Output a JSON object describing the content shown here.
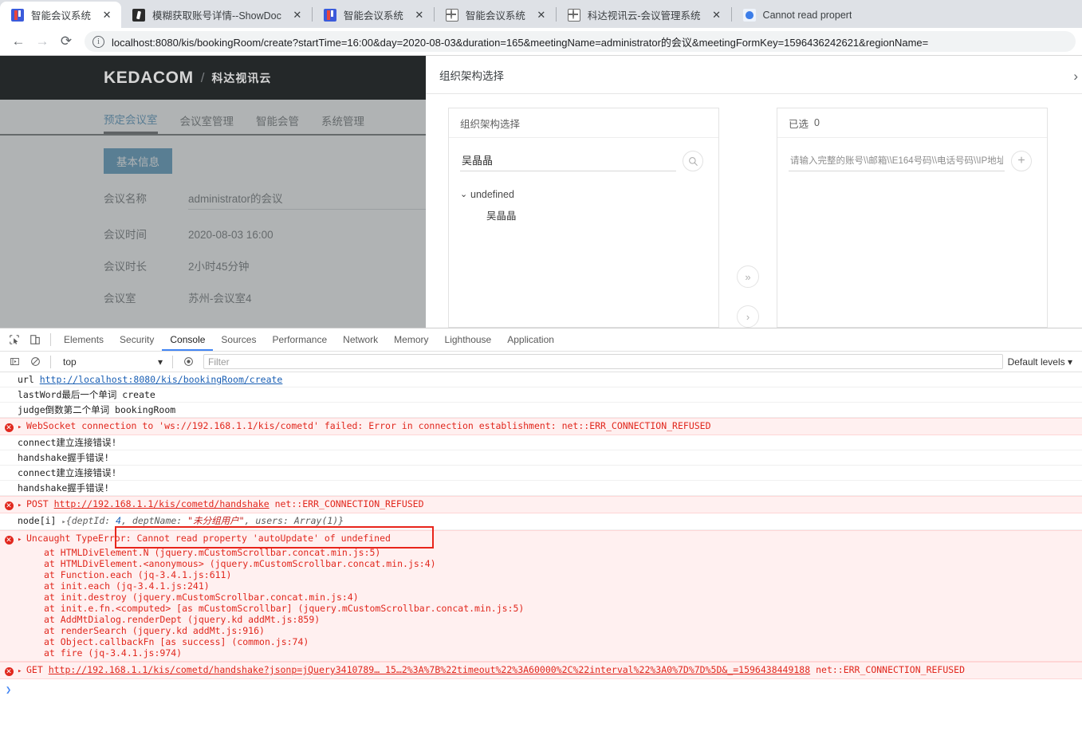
{
  "browser": {
    "tabs": [
      {
        "title": "智能会议系统",
        "favicon": "fiddler-icon",
        "active": true,
        "close": "✕"
      },
      {
        "title": "模糊获取账号详情--ShowDoc",
        "favicon": "showdoc-icon",
        "active": false,
        "close": "✕"
      },
      {
        "title": "智能会议系统",
        "favicon": "fiddler-icon",
        "active": false,
        "close": "✕"
      },
      {
        "title": "智能会议系统",
        "favicon": "globe-icon",
        "active": false,
        "close": "✕"
      },
      {
        "title": "科达视讯云-会议管理系统",
        "favicon": "globe-icon",
        "active": false,
        "close": "✕"
      },
      {
        "title": "Cannot read propert",
        "favicon": "baidu-icon",
        "active": false,
        "close": ""
      }
    ],
    "nav": {
      "back": "←",
      "forward": "→",
      "reload": "⟳",
      "info": "ⓘ"
    },
    "url": "localhost:8080/kis/bookingRoom/create?startTime=16:00&day=2020-08-03&duration=165&meetingName=administrator的会议&meetingFormKey=1596436242621&regionName="
  },
  "page": {
    "brand": {
      "name": "KEDACOM",
      "separator": "/",
      "subtitle": "科达视讯云"
    },
    "nav_tabs": [
      {
        "label": "预定会议室",
        "active": true
      },
      {
        "label": "会议室管理",
        "active": false
      },
      {
        "label": "智能会管",
        "active": false
      },
      {
        "label": "系统管理",
        "active": false
      }
    ],
    "section_button": "基本信息",
    "form": [
      {
        "label": "会议名称",
        "value": "administrator的会议",
        "underlined": true
      },
      {
        "label": "会议时间",
        "value": "2020-08-03 16:00",
        "underlined": false
      },
      {
        "label": "会议时长",
        "value": "2小时45分钟",
        "underlined": false
      },
      {
        "label": "会议室",
        "value": "苏州-会议室4",
        "underlined": false
      }
    ]
  },
  "modal": {
    "title": "组织架构选择",
    "close_icon": "›",
    "left_panel": {
      "header": "组织架构选择",
      "search_value": "吴晶晶",
      "search_placeholder": "",
      "search_icon": "search-icon",
      "tree": {
        "caret": "⌄",
        "root_label": "undefined",
        "children": [
          "吴晶晶"
        ]
      }
    },
    "transfer": {
      "move_all_icon": "»",
      "move_one_icon": "›"
    },
    "right_panel": {
      "header": "已选",
      "count": "0",
      "input_value": "",
      "input_placeholder": "请输入完整的账号\\\\邮箱\\\\E164号码\\\\电话号码\\\\IP地址",
      "add_icon": "+"
    }
  },
  "devtools": {
    "toolbar_icons": [
      "inspect-element-icon",
      "device-toolbar-icon"
    ],
    "tabs": [
      {
        "label": "Elements",
        "active": false
      },
      {
        "label": "Security",
        "active": false
      },
      {
        "label": "Console",
        "active": true
      },
      {
        "label": "Sources",
        "active": false
      },
      {
        "label": "Performance",
        "active": false
      },
      {
        "label": "Network",
        "active": false
      },
      {
        "label": "Memory",
        "active": false
      },
      {
        "label": "Lighthouse",
        "active": false
      },
      {
        "label": "Application",
        "active": false
      }
    ],
    "filterbar": {
      "execute_icon": "▶|",
      "clear_icon": "⊘",
      "context": "top",
      "context_caret": "▾",
      "eye_icon": "◉",
      "filter_placeholder": "Filter",
      "filter_value": "",
      "levels": "Default levels ▾"
    },
    "console_rows": [
      {
        "type": "log",
        "text": "url ",
        "link": "http://localhost:8080/kis/bookingRoom/create"
      },
      {
        "type": "log",
        "text": "lastWord最后一个单词 create"
      },
      {
        "type": "log",
        "text": "judge倒数第二个单词 bookingRoom"
      },
      {
        "type": "error",
        "caret": "▸",
        "text": "WebSocket connection to 'ws://192.168.1.1/kis/cometd' failed: Error in connection establishment: net::ERR_CONNECTION_REFUSED"
      },
      {
        "type": "log",
        "text": "connect建立连接错误!"
      },
      {
        "type": "log",
        "text": "handshake握手错误!"
      },
      {
        "type": "log",
        "text": "connect建立连接错误!"
      },
      {
        "type": "log",
        "text": "handshake握手错误!"
      },
      {
        "type": "error",
        "caret": "▸",
        "prefix": "POST ",
        "link": "http://192.168.1.1/kis/cometd/handshake",
        "suffix": " net::ERR_CONNECTION_REFUSED"
      },
      {
        "type": "object",
        "label": "node[i] ",
        "caret": "▸",
        "preview_open": "{deptId: ",
        "preview_num": "4",
        "preview_mid": ", deptName: ",
        "preview_str": "\"未分组用户\"",
        "preview_end": ", users: Array(1)}"
      },
      {
        "type": "error",
        "caret": "▸",
        "text": "Uncaught TypeError: Cannot read property 'autoUpdate' of undefined",
        "stack": [
          "at HTMLDivElement.N (jquery.mCustomScrollbar.concat.min.js:5)",
          "at HTMLDivElement.<anonymous> (jquery.mCustomScrollbar.concat.min.js:4)",
          "at Function.each (jq-3.4.1.js:611)",
          "at init.each (jq-3.4.1.js:241)",
          "at init.destroy (jquery.mCustomScrollbar.concat.min.js:4)",
          "at init.e.fn.<computed> [as mCustomScrollbar] (jquery.mCustomScrollbar.concat.min.js:5)",
          "at AddMtDialog.renderDept (jquery.kd addMt.js:859)",
          "at renderSearch (jquery.kd addMt.js:916)",
          "at Object.callbackFn [as success] (common.js:74)",
          "at fire (jq-3.4.1.js:974)"
        ]
      },
      {
        "type": "error",
        "caret": "▸",
        "prefix": "GET ",
        "link": "http://192.168.1.1/kis/cometd/handshake?jsonp=jQuery3410789… 15…2%3A%7B%22timeout%22%3A60000%2C%22interval%22%3A0%7D%7D%5D&_=1596438449188",
        "suffix": " net::ERR_CONNECTION_REFUSED"
      }
    ],
    "prompt_caret": "❯",
    "highlight_color": "#e8251b"
  }
}
